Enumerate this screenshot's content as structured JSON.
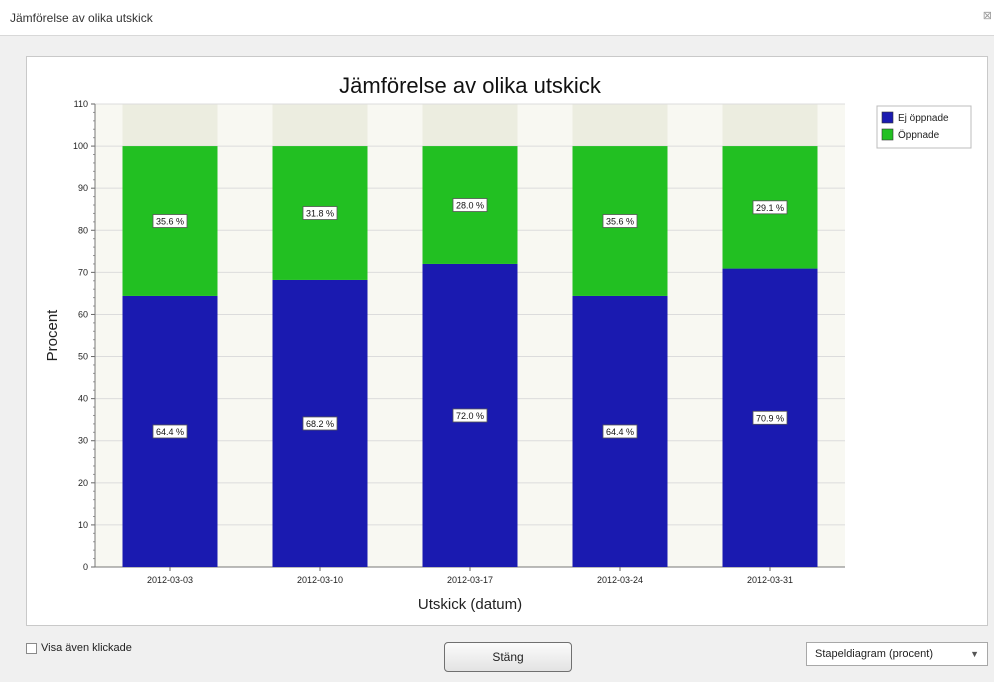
{
  "window": {
    "title": "Jämförelse av olika utskick",
    "close_label": "⊠"
  },
  "colors": {
    "ej_oppnade": "#1a1ab0",
    "oppnade": "#22c022",
    "band_light": "#f8f8f2",
    "band_dark": "#ecede0"
  },
  "chart_data": {
    "type": "bar",
    "stacked": true,
    "title": "Jämförelse av olika utskick",
    "xlabel": "Utskick (datum)",
    "ylabel": "Procent",
    "ylim": [
      0,
      110
    ],
    "yticks": [
      0,
      10,
      20,
      30,
      40,
      50,
      60,
      70,
      80,
      90,
      100,
      110
    ],
    "categories": [
      "2012-03-03",
      "2012-03-10",
      "2012-03-17",
      "2012-03-24",
      "2012-03-31"
    ],
    "series": [
      {
        "name": "Ej öppnade",
        "values": [
          64.4,
          68.2,
          72.0,
          64.4,
          70.9
        ],
        "labels": [
          "64.4 %",
          "68.2 %",
          "72.0 %",
          "64.4 %",
          "70.9 %"
        ]
      },
      {
        "name": "Öppnade",
        "values": [
          35.6,
          31.8,
          28.0,
          35.6,
          29.1
        ],
        "labels": [
          "35.6 %",
          "31.8 %",
          "28.0 %",
          "35.6 %",
          "29.1 %"
        ]
      }
    ],
    "legend": "top-right",
    "grid": true
  },
  "controls": {
    "checkbox_label": "Visa även klickade",
    "checkbox_checked": false,
    "close_button": "Stäng",
    "chart_type_selected": "Stapeldiagram (procent)"
  }
}
